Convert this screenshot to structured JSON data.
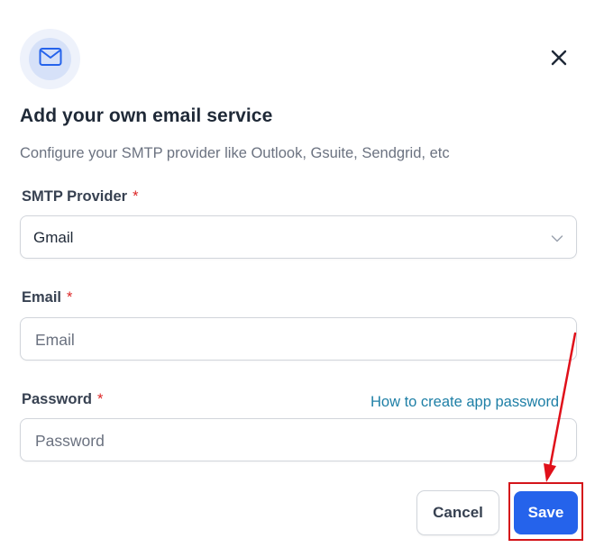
{
  "dialog": {
    "title": "Add your own email service",
    "subtitle": "Configure your SMTP provider like Outlook, Gsuite, Sendgrid, etc"
  },
  "form": {
    "provider": {
      "label": "SMTP Provider",
      "required_mark": "*",
      "value": "Gmail"
    },
    "email": {
      "label": "Email",
      "required_mark": "*",
      "placeholder": "Email"
    },
    "password": {
      "label": "Password",
      "required_mark": "*",
      "placeholder": "Password",
      "help_link": "How to create app password"
    }
  },
  "actions": {
    "cancel_label": "Cancel",
    "save_label": "Save"
  },
  "icons": {
    "header": "mail-icon",
    "close": "close-icon",
    "select": "chevron-down-icon"
  },
  "colors": {
    "primary": "#2563eb",
    "link": "#1e7fa6",
    "required": "#dc2626",
    "annotation": "#d4141a"
  }
}
